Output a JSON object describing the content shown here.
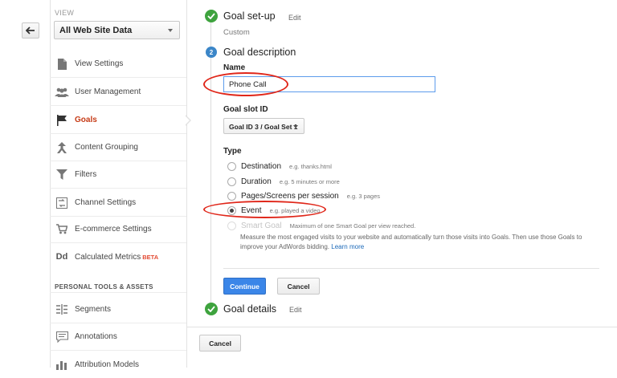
{
  "view": {
    "label": "VIEW",
    "selected": "All Web Site Data"
  },
  "nav": {
    "items": [
      {
        "label": "View Settings",
        "icon": "document-icon"
      },
      {
        "label": "User Management",
        "icon": "users-icon"
      },
      {
        "label": "Goals",
        "icon": "flag-icon",
        "active": true
      },
      {
        "label": "Content Grouping",
        "icon": "grouping-icon"
      },
      {
        "label": "Filters",
        "icon": "filter-icon"
      },
      {
        "label": "Channel Settings",
        "icon": "channel-icon"
      },
      {
        "label": "E-commerce Settings",
        "icon": "cart-icon"
      },
      {
        "label": "Calculated Metrics",
        "icon": "dd-icon",
        "badge": "BETA"
      }
    ],
    "section_header": "PERSONAL TOOLS & ASSETS",
    "tools": [
      {
        "label": "Segments",
        "icon": "segments-icon"
      },
      {
        "label": "Annotations",
        "icon": "annotations-icon"
      },
      {
        "label": "Attribution Models",
        "icon": "bar-chart-icon"
      }
    ]
  },
  "steps": {
    "setup": {
      "title": "Goal set-up",
      "edit": "Edit",
      "subtitle": "Custom"
    },
    "description": {
      "number": "2",
      "title": "Goal description",
      "name_label": "Name",
      "name_value": "Phone Call",
      "slot_label": "Goal slot ID",
      "slot_value": "Goal ID 3 / Goal Set 1",
      "type_label": "Type",
      "types": [
        {
          "label": "Destination",
          "example": "e.g. thanks.html",
          "selected": false
        },
        {
          "label": "Duration",
          "example": "e.g. 5 minutes or more",
          "selected": false
        },
        {
          "label": "Pages/Screens per session",
          "example": "e.g. 3 pages",
          "selected": false
        },
        {
          "label": "Event",
          "example": "e.g. played a video",
          "selected": true
        },
        {
          "label": "Smart Goal",
          "example": "Maximum of one Smart Goal per view reached.",
          "disabled": true
        }
      ],
      "smart_desc": "Measure the most engaged visits to your website and automatically turn those visits into Goals. Then use those Goals to improve your AdWords bidding.",
      "learn_more": "Learn more",
      "continue": "Continue",
      "cancel": "Cancel"
    },
    "details": {
      "title": "Goal details",
      "edit": "Edit"
    }
  },
  "footer": {
    "cancel": "Cancel"
  },
  "colors": {
    "accent": "#3b86e8",
    "active_nav": "#c63b16",
    "check": "#3ea33e",
    "annotation": "#e0271a"
  }
}
